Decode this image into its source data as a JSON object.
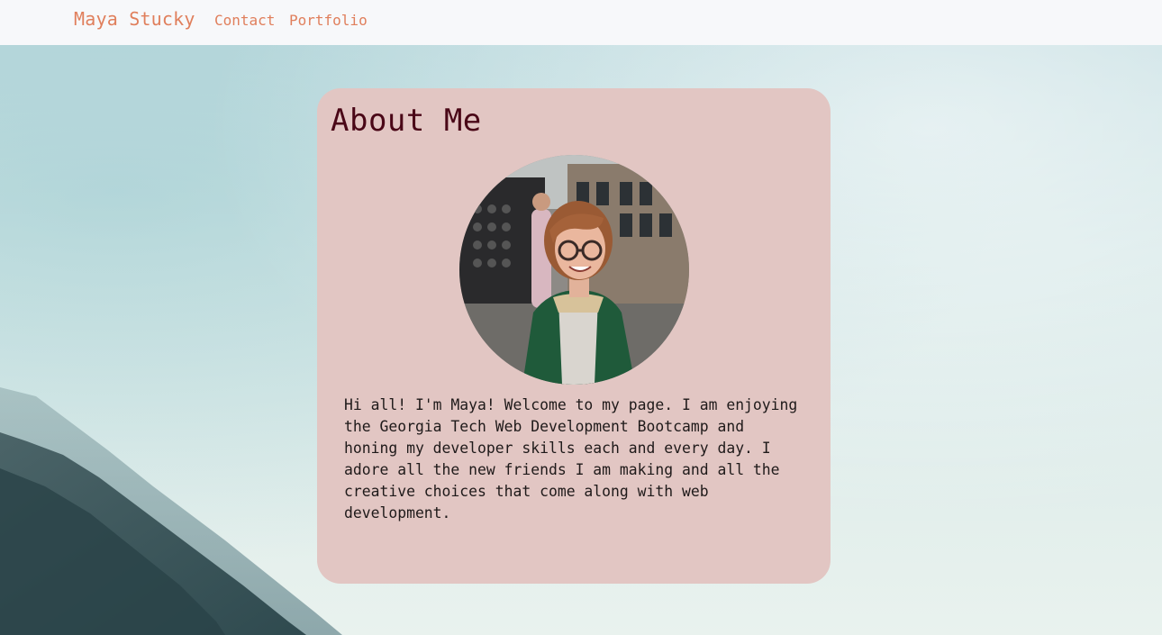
{
  "nav": {
    "brand": "Maya Stucky",
    "links": [
      {
        "label": "Contact"
      },
      {
        "label": "Portfolio"
      }
    ]
  },
  "about": {
    "title": "About Me",
    "bio": "Hi all! I'm Maya! Welcome to my page. I am enjoying the Georgia Tech Web Development Bootcamp and honing my developer skills each and every day. I adore all the new friends I am making and all the creative choices that come along with web development."
  },
  "colors": {
    "accent": "#e07f5c",
    "card": "#e2c6c3",
    "title": "#4a0717",
    "navbar": "#f7f8fa"
  }
}
